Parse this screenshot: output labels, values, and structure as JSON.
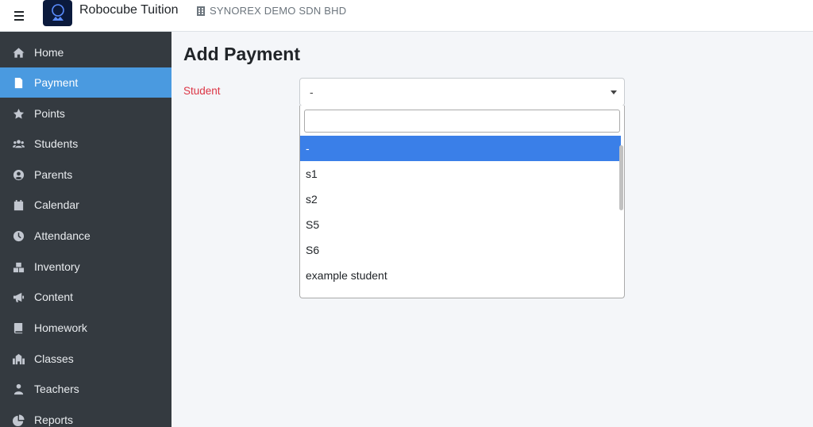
{
  "header": {
    "menu_icon": "hamburger-icon",
    "brand": "Robocube Tuition",
    "company": "SYNOREX DEMO SDN BHD",
    "company_icon": "building-icon"
  },
  "sidebar": {
    "items": [
      {
        "label": "Home",
        "icon": "home-icon"
      },
      {
        "label": "Payment",
        "icon": "document-icon",
        "active": true
      },
      {
        "label": "Points",
        "icon": "star-icon"
      },
      {
        "label": "Students",
        "icon": "users-icon"
      },
      {
        "label": "Parents",
        "icon": "user-circle-icon"
      },
      {
        "label": "Calendar",
        "icon": "calendar-icon"
      },
      {
        "label": "Attendance",
        "icon": "clock-icon"
      },
      {
        "label": "Inventory",
        "icon": "boxes-icon"
      },
      {
        "label": "Content",
        "icon": "megaphone-icon"
      },
      {
        "label": "Homework",
        "icon": "book-icon"
      },
      {
        "label": "Classes",
        "icon": "school-icon"
      },
      {
        "label": "Teachers",
        "icon": "teacher-icon"
      },
      {
        "label": "Reports",
        "icon": "pie-chart-icon"
      }
    ]
  },
  "main": {
    "title": "Add Payment",
    "student_label": "Student",
    "student_selected": "-",
    "search_value": "",
    "options": [
      "-",
      "s1",
      "s2",
      "S5",
      "S6",
      "example student"
    ]
  },
  "colors": {
    "sidebar_bg": "#343a40",
    "active_item": "#4a9ae0",
    "highlight_option": "#3a7fe8",
    "required_label": "#dc3545"
  }
}
